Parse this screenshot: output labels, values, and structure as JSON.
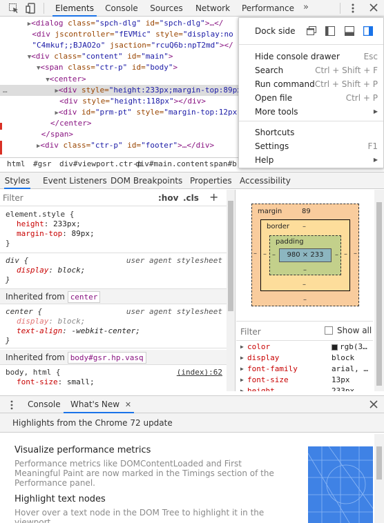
{
  "toolbar": {
    "tabs": [
      "Elements",
      "Console",
      "Sources",
      "Network",
      "Performance"
    ],
    "active_tab": "Elements",
    "more_tabs_icon": "chevron-double-right-icon",
    "kebab_icon": "kebab-icon",
    "close_icon": "close-icon"
  },
  "tree": {
    "lines": [
      {
        "ind": "      ",
        "tri": "▶",
        "pre": "<",
        "tag": "dialog",
        "a1": " class=",
        "v1": "\"spch-dlg\"",
        "a2": " id=",
        "v2": "\"spch-dlg\"",
        "post": ">…</"
      },
      {
        "ind": "       ",
        "tri": "",
        "pre": "<",
        "tag": "div",
        "a1": " jscontroller=",
        "v1": "\"fEVMic\"",
        "a2": " style=",
        "v2": "\"display:no",
        "post": ""
      },
      {
        "ind": "       ",
        "tri": "",
        "pre": "",
        "tag": "",
        "a1": "",
        "v1": "\"C4mkuf;;BJAO2o\"",
        "a2": " jsaction=",
        "v2": "\"rcuQ6b:npT2md\"",
        "post": "></"
      },
      {
        "ind": "      ",
        "tri": "▼",
        "pre": "<",
        "tag": "div",
        "a1": " class=",
        "v1": "\"content\"",
        "a2": " id=",
        "v2": "\"main\"",
        "post": ">"
      },
      {
        "ind": "        ",
        "tri": "▼",
        "pre": "<",
        "tag": "span",
        "a1": " class=",
        "v1": "\"ctr-p\"",
        "a2": " id=",
        "v2": "\"body\"",
        "post": ">"
      },
      {
        "ind": "          ",
        "tri": "▼",
        "pre": "<",
        "tag": "center",
        "a1": "",
        "v1": "",
        "a2": "",
        "v2": "",
        "post": ">"
      },
      {
        "ind": "            ",
        "tri": "▶",
        "pre": "<",
        "tag": "div",
        "a1": " style=",
        "v1": "\"height:233px;margin-top:89px",
        "a2": "",
        "v2": "",
        "post": ""
      },
      {
        "ind": "             ",
        "tri": "",
        "pre": "<",
        "tag": "div",
        "a1": " style=",
        "v1": "\"height:118px\"",
        "a2": "",
        "v2": "",
        "post": "></div>"
      },
      {
        "ind": "            ",
        "tri": "▶",
        "pre": "<",
        "tag": "div",
        "a1": " id=",
        "v1": "\"prm-pt\"",
        "a2": " style=",
        "v2": "\"margin-top:12px",
        "post": ""
      },
      {
        "ind": "           ",
        "tri": "",
        "pre": "</",
        "tag": "center",
        "a1": "",
        "v1": "",
        "a2": "",
        "v2": "",
        "post": ">"
      },
      {
        "ind": "         ",
        "tri": "",
        "pre": "</",
        "tag": "span",
        "a1": "",
        "v1": "",
        "a2": "",
        "v2": "",
        "post": ">"
      },
      {
        "ind": "        ",
        "tri": "▶",
        "pre": "<",
        "tag": "div",
        "a1": " class=",
        "v1": "\"ctr-p\"",
        "a2": " id=",
        "v2": "\"footer\"",
        "post": ">…</div>"
      }
    ],
    "ellipsis": "…"
  },
  "breadcrumbs": [
    "html",
    "#gsr",
    "div#viewport.ctr-p",
    "div#main.content",
    "span#b"
  ],
  "subtabs": [
    "Styles",
    "Event Listeners",
    "DOM Breakpoints",
    "Properties",
    "Accessibility"
  ],
  "styles": {
    "filter_placeholder": "Filter",
    "hov": ":hov",
    "cls": ".cls",
    "add": "+",
    "element_style": "element.style {",
    "el_props": [
      {
        "p": "height",
        "v": "233px;"
      },
      {
        "p": "margin-top",
        "v": "89px;"
      }
    ],
    "close_brace": "}",
    "div_rule": "div {",
    "ua": "user agent stylesheet",
    "div_prop": {
      "p": "display",
      "v": "block;"
    },
    "inherited_from": "Inherited from",
    "inh1": "center",
    "center_rule": "center {",
    "center_props": [
      {
        "p": "display",
        "v": "block;"
      },
      {
        "p": "text-align",
        "v": "-webkit-center;"
      }
    ],
    "inh2": "body#gsr.hp.vasq",
    "body_rule": "body, html {",
    "body_src": "(index):62",
    "body_prop": {
      "p": "font-size",
      "v": "small;"
    }
  },
  "boxmodel": {
    "margin_label": "margin",
    "margin_top": "89",
    "border_label": "border",
    "padding_label": "padding",
    "content": "980 × 233",
    "dash": "–"
  },
  "computed": {
    "filter_placeholder": "Filter",
    "show_all": "Show all",
    "rows": [
      {
        "p": "color",
        "v": "rgb(3…"
      },
      {
        "p": "display",
        "v": "block"
      },
      {
        "p": "font-family",
        "v": "arial, …"
      },
      {
        "p": "font-size",
        "v": "13px"
      },
      {
        "p": "height",
        "v": "233px"
      }
    ],
    "color_swatch": "#222222"
  },
  "drawer": {
    "tabs": [
      "Console",
      "What's New"
    ],
    "active": "What's New",
    "header": "Highlights from the Chrome 72 update",
    "items": [
      {
        "title": "Visualize performance metrics",
        "body": "Performance metrics like DOMContentLoaded and First Meaningful Paint are now marked in the Timings section of the Performance panel."
      },
      {
        "title": "Highlight text nodes",
        "body": "Hover over a text node in the DOM Tree to highlight it in the viewport."
      }
    ]
  },
  "menu": {
    "dock_side": "Dock side",
    "items1": [
      {
        "label": "Hide console drawer",
        "sc": "Esc"
      },
      {
        "label": "Search",
        "sc": "Ctrl + Shift + F"
      },
      {
        "label": "Run command",
        "sc": "Ctrl + Shift + P"
      },
      {
        "label": "Open file",
        "sc": "Ctrl + P"
      },
      {
        "label": "More tools",
        "sc": "▶"
      }
    ],
    "items2": [
      {
        "label": "Shortcuts",
        "sc": ""
      },
      {
        "label": "Settings",
        "sc": "F1"
      },
      {
        "label": "Help",
        "sc": "▶"
      }
    ]
  },
  "colors": {
    "accent": "#1a73e8",
    "tag": "#881280",
    "attr_name": "#994500",
    "attr_value": "#1a1aa6",
    "prop": "#c80000",
    "margin": "#f9cc9d",
    "border_box": "#fddd9b",
    "padding": "#c3d08b",
    "content": "#8cb6c0"
  }
}
